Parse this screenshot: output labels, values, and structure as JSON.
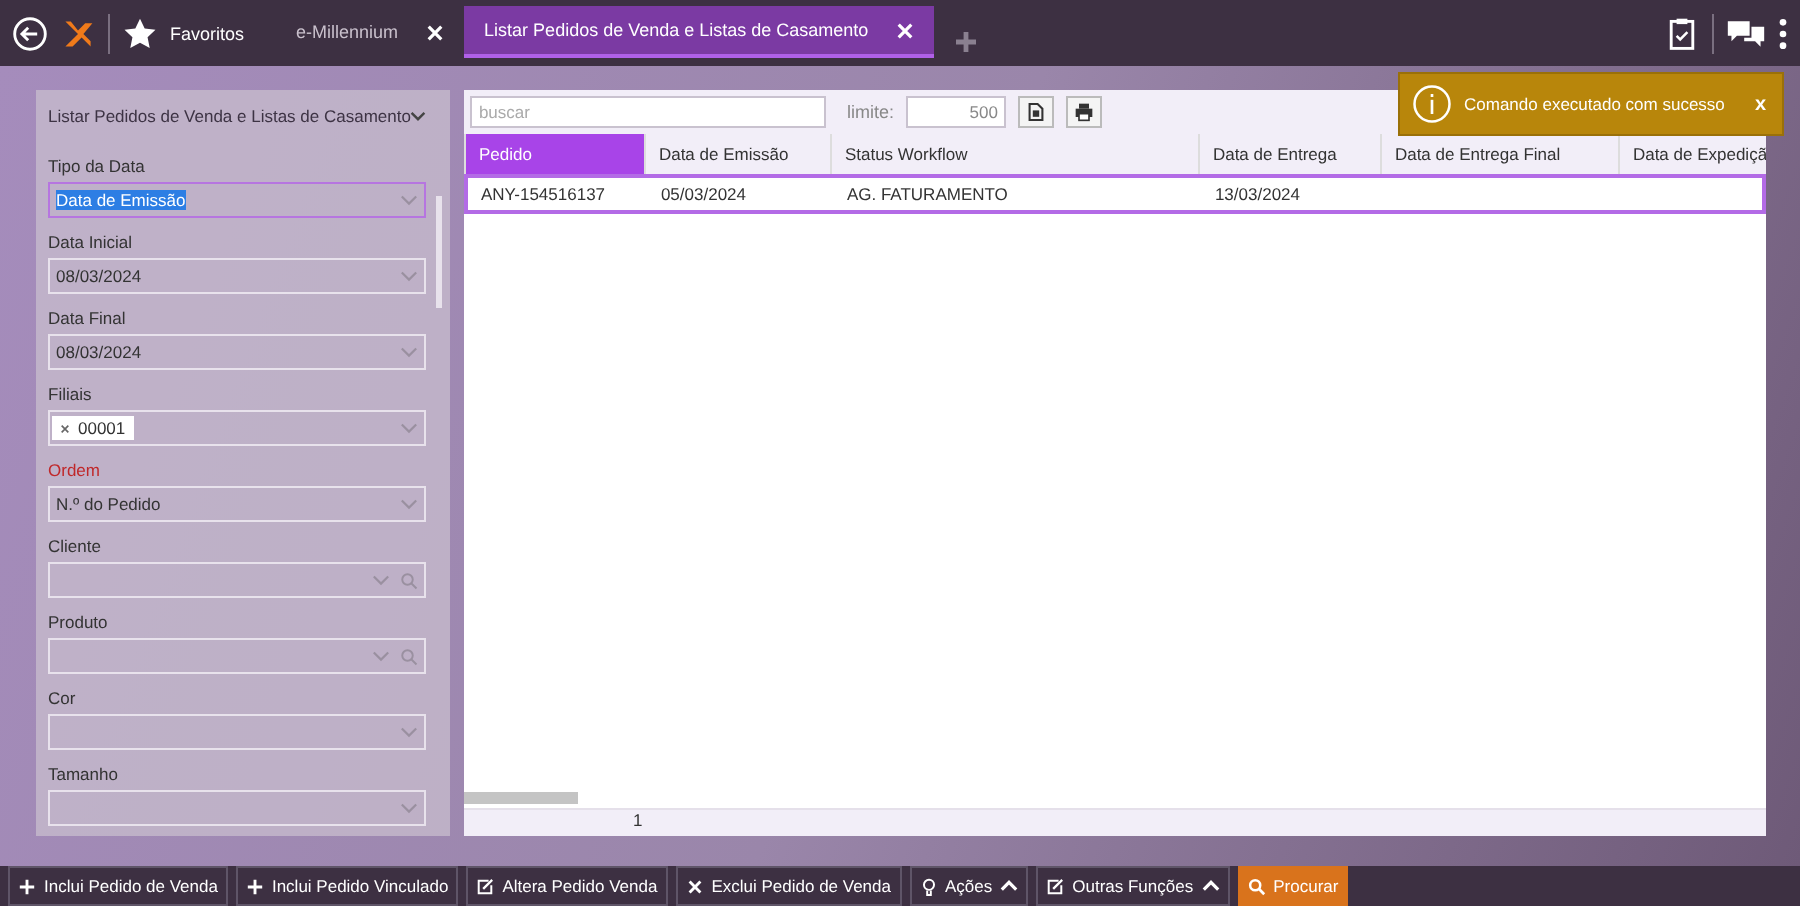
{
  "top_bar": {
    "favorites": "Favoritos",
    "tabs": [
      {
        "label": "e-Millennium",
        "selected": false
      },
      {
        "label": "Listar Pedidos de Venda e Listas de Casamento",
        "selected": true
      }
    ]
  },
  "filter_panel": {
    "title": "Listar Pedidos de Venda e Listas de Casamento",
    "fields": [
      {
        "label": "Tipo da Data",
        "value": "Data de Emissão",
        "kind": "select",
        "highlighted": true,
        "required": false
      },
      {
        "label": "Data Inicial",
        "value": "08/03/2024",
        "kind": "select",
        "highlighted": false,
        "required": false
      },
      {
        "label": "Data Final",
        "value": "08/03/2024",
        "kind": "select",
        "highlighted": false,
        "required": false
      },
      {
        "label": "Filiais",
        "tags": [
          "00001"
        ],
        "kind": "tags",
        "highlighted": false,
        "required": false
      },
      {
        "label": "Ordem",
        "value": "N.º do Pedido",
        "kind": "select",
        "highlighted": false,
        "required": true
      },
      {
        "label": "Cliente",
        "kind": "lookup",
        "highlighted": false,
        "required": false
      },
      {
        "label": "Produto",
        "kind": "lookup",
        "highlighted": false,
        "required": false
      },
      {
        "label": "Cor",
        "kind": "select",
        "highlighted": false,
        "required": false
      },
      {
        "label": "Tamanho",
        "kind": "select",
        "highlighted": false,
        "required": false
      }
    ]
  },
  "results": {
    "search": {
      "placeholder": "buscar"
    },
    "limit_label": "limite:",
    "limit": "500",
    "columns": [
      {
        "label": "Pedido",
        "selected": true
      },
      {
        "label": "Data de Emissão",
        "selected": false
      },
      {
        "label": "Status Workflow",
        "selected": false
      },
      {
        "label": "Data de Entrega",
        "selected": false
      },
      {
        "label": "Data de Entrega Final",
        "selected": false
      },
      {
        "label": "Data de Expediçã",
        "selected": false
      }
    ],
    "rows": [
      {
        "selected": true,
        "cells": [
          "ANY-154516137",
          "05/03/2024",
          "AG. FATURAMENTO",
          "13/03/2024",
          "",
          ""
        ]
      }
    ],
    "footer": "1"
  },
  "toast": {
    "message": "Comando executado com sucesso",
    "close": "x"
  },
  "actions": [
    {
      "label": "Inclui Pedido de Venda",
      "kind": "add",
      "primary": false,
      "caret": false
    },
    {
      "label": "Inclui Pedido Vinculado",
      "kind": "add",
      "primary": false,
      "caret": false
    },
    {
      "label": "Altera Pedido Venda",
      "kind": "edit",
      "primary": false,
      "caret": false
    },
    {
      "label": "Exclui Pedido de Venda",
      "kind": "delete",
      "primary": false,
      "caret": false
    },
    {
      "label": "Ações",
      "kind": "menu",
      "caret": true,
      "primary": false
    },
    {
      "label": "Outras Funções",
      "kind": "edit",
      "caret": true,
      "primary": false
    },
    {
      "label": "Procurar",
      "kind": "search",
      "primary": true,
      "caret": false
    }
  ]
}
